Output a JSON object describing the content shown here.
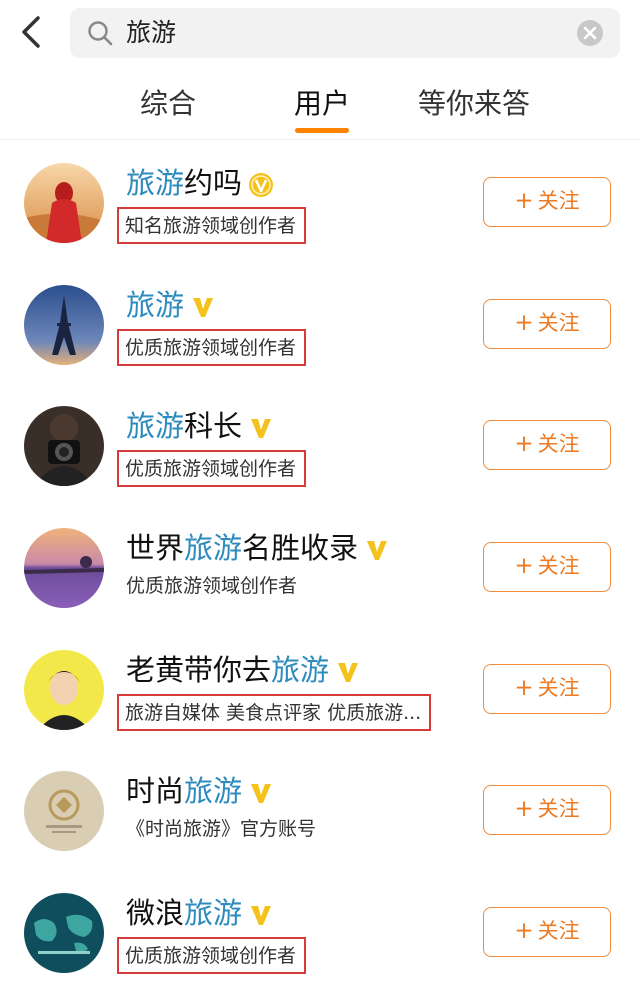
{
  "search": {
    "query": "旅游"
  },
  "tabs": [
    {
      "label": "综合",
      "active": false
    },
    {
      "label": "用户",
      "active": true
    },
    {
      "label": "等你来答",
      "active": false
    }
  ],
  "colors": {
    "accent": "#ff8200",
    "highlight": "#2e8bbd",
    "follow": "#ee7a22",
    "box": "#d63a3a"
  },
  "users": [
    {
      "name_pre": "",
      "name_hl": "旅游",
      "name_post": "约吗",
      "badge": "gold-v-circle-icon",
      "desc": "知名旅游领域创作者",
      "follow": "关注"
    },
    {
      "name_pre": "",
      "name_hl": "旅游",
      "name_post": "",
      "badge": "gold-v-icon",
      "desc": "优质旅游领域创作者",
      "follow": "关注"
    },
    {
      "name_pre": "",
      "name_hl": "旅游",
      "name_post": "科长",
      "badge": "gold-v-icon",
      "desc": "优质旅游领域创作者",
      "follow": "关注"
    },
    {
      "name_pre": "世界",
      "name_hl": "旅游",
      "name_post": "名胜收录",
      "badge": "gold-v-icon",
      "desc": "优质旅游领域创作者",
      "follow": "关注"
    },
    {
      "name_pre": "老黄带你去",
      "name_hl": "旅游",
      "name_post": "",
      "badge": "gold-v-icon",
      "desc": "旅游自媒体 美食点评家 优质旅游...",
      "follow": "关注"
    },
    {
      "name_pre": "时尚",
      "name_hl": "旅游",
      "name_post": "",
      "badge": "gold-v-icon",
      "desc": "《时尚旅游》官方账号",
      "follow": "关注"
    },
    {
      "name_pre": "微浪",
      "name_hl": "旅游",
      "name_post": "",
      "badge": "gold-v-icon",
      "desc": "优质旅游领域创作者",
      "follow": "关注"
    }
  ]
}
